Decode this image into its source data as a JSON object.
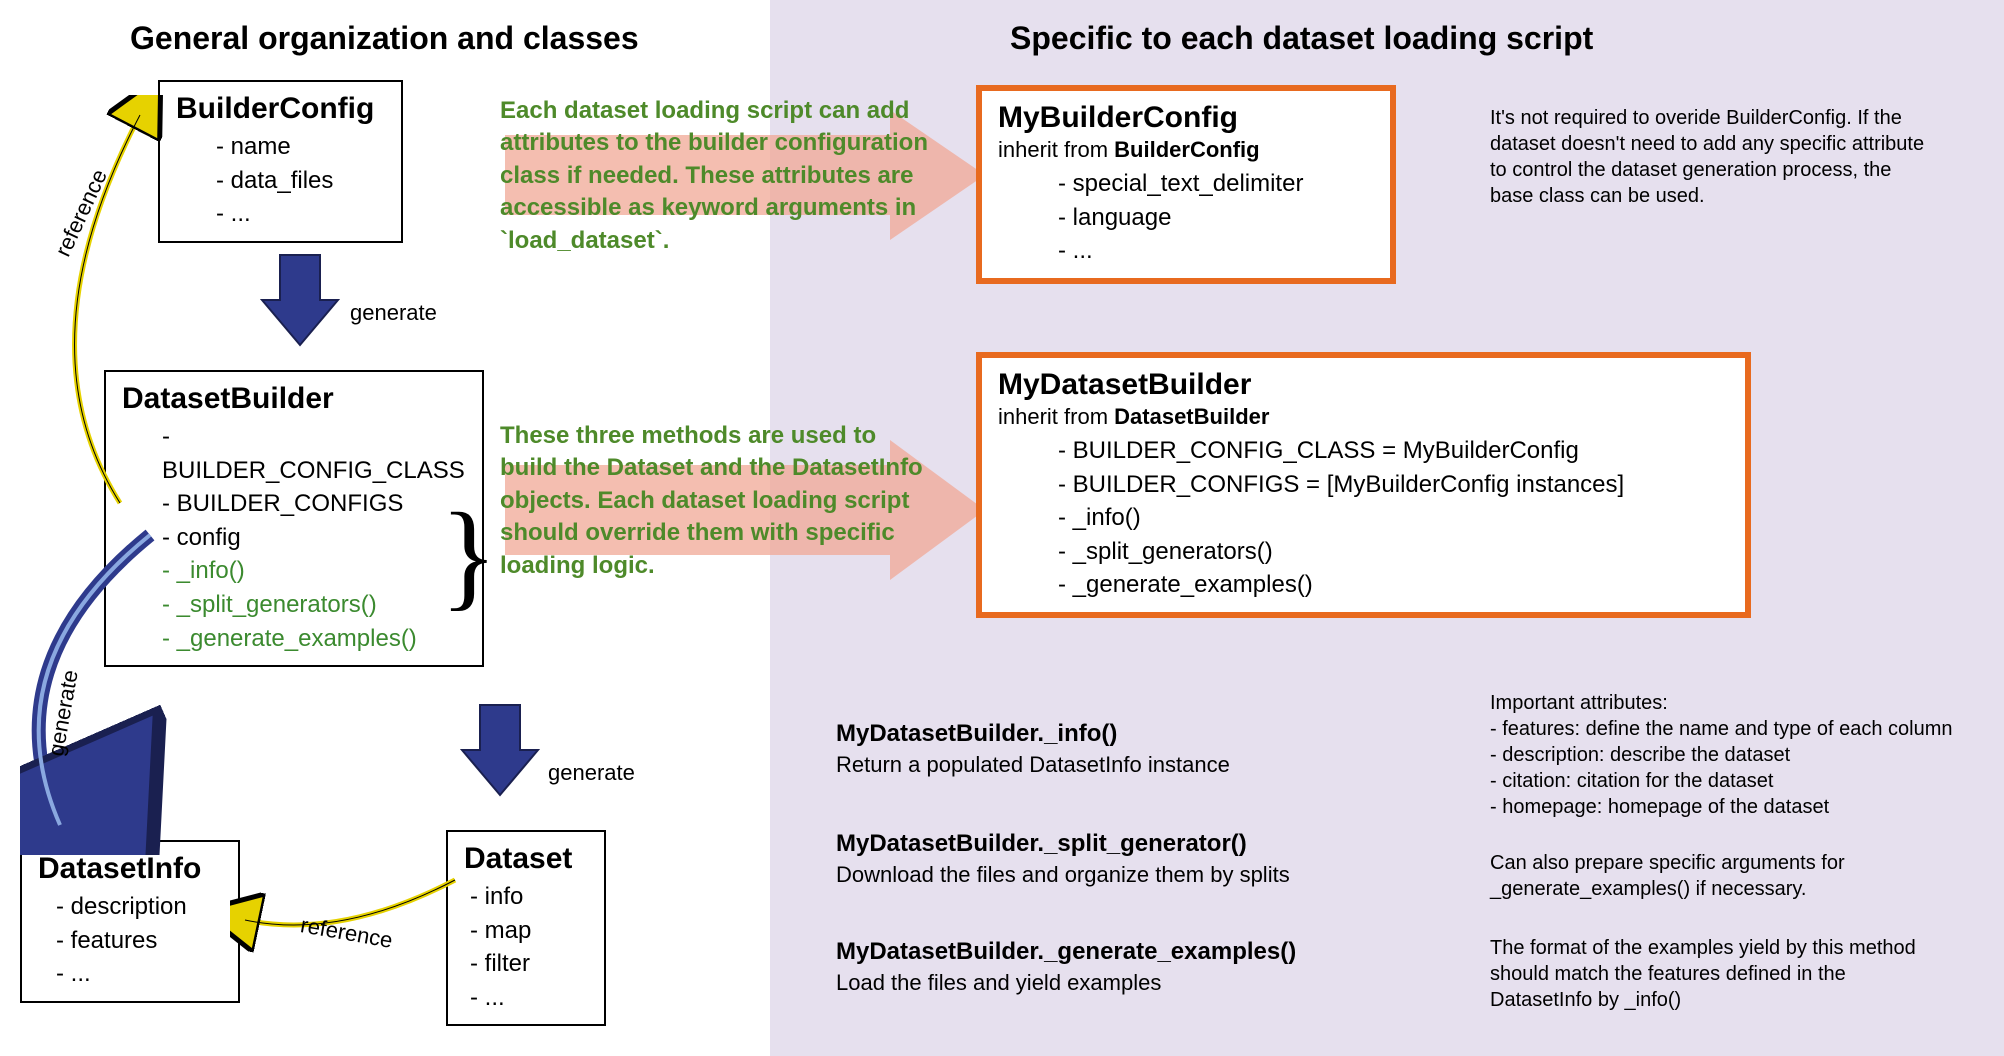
{
  "left": {
    "heading": "General organization and classes",
    "builderConfig": {
      "title": "BuilderConfig",
      "attrs": [
        "- name",
        "- data_files",
        "- ..."
      ]
    },
    "datasetBuilder": {
      "title": "DatasetBuilder",
      "attrs": [
        "- BUILDER_CONFIG_CLASS",
        "- BUILDER_CONFIGS",
        "- config"
      ],
      "methods": [
        "- _info()",
        "- _split_generators()",
        "- _generate_examples()"
      ]
    },
    "datasetInfo": {
      "title": "DatasetInfo",
      "attrs": [
        "- description",
        "- features",
        "- ..."
      ]
    },
    "dataset": {
      "title": "Dataset",
      "attrs": [
        "- info",
        "- map",
        "- filter",
        "- ..."
      ]
    },
    "labels": {
      "reference1": "reference",
      "generate1": "generate",
      "generate2": "generate",
      "generate3": "generate",
      "reference2": "reference"
    }
  },
  "annotations": {
    "top": "Each dataset loading script can add attributes to the builder configuration class if needed. These attributes are accessible as keyword arguments in `load_dataset`.",
    "middle": "These three methods are used to build the Dataset and the DatasetInfo objects. Each dataset loading script should override them with specific loading logic."
  },
  "right": {
    "heading": "Specific to each dataset loading script",
    "myBuilderConfig": {
      "title": "MyBuilderConfig",
      "inherit": "inherit from ",
      "inheritClass": "BuilderConfig",
      "attrs": [
        "- special_text_delimiter",
        "- language",
        "- ..."
      ]
    },
    "myDatasetBuilder": {
      "title": "MyDatasetBuilder",
      "inherit": "inherit from ",
      "inheritClass": "DatasetBuilder",
      "attrs": [
        "- BUILDER_CONFIG_CLASS = MyBuilderConfig",
        "- BUILDER_CONFIGS = [MyBuilderConfig instances]",
        "- _info()",
        "- _split_generators()",
        "- _generate_examples()"
      ]
    },
    "notes": {
      "configNote": "It's not required to overide BuilderConfig. If the dataset doesn't need to add any specific attribute to control the dataset generation process, the base class can be used.",
      "infoNote": "Important attributes:\n- features: define the name and type of each column\n- description: describe the dataset\n- citation: citation for the dataset\n- homepage: homepage of the dataset",
      "splitNote": "Can also prepare specific arguments for _generate_examples() if necessary.",
      "genNote": "The format of the examples yield by this method should match the features defined in the DatasetInfo by _info()"
    },
    "methods": {
      "info": {
        "title": "MyDatasetBuilder._info()",
        "desc": "Return a populated DatasetInfo instance"
      },
      "split": {
        "title": "MyDatasetBuilder._split_generator()",
        "desc": "Download the files and organize them by splits"
      },
      "gen": {
        "title": "MyDatasetBuilder._generate_examples()",
        "desc": "Load the files and yield examples"
      }
    }
  }
}
